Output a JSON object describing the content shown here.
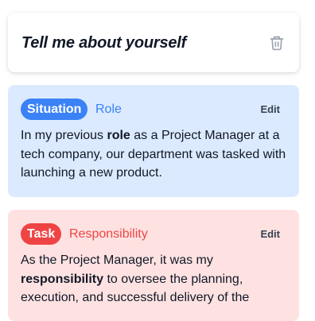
{
  "question": {
    "title": "Tell me about yourself",
    "delete_icon": "trash-icon"
  },
  "cards": [
    {
      "badge": "Situation",
      "subtitle": "Role",
      "edit_label": "Edit",
      "body_before": "In my previous ",
      "body_bold": "role",
      "body_after": " as a Project Manager at a tech company, our department was tasked with launching a new product.",
      "colors": {
        "background": "#dbeafe",
        "accent": "#3b82f6"
      }
    },
    {
      "badge": "Task",
      "subtitle": "Responsibility",
      "edit_label": "Edit",
      "body_before": "As the Project Manager, it was my ",
      "body_bold": "responsibility",
      "body_after": " to oversee the planning, execution, and successful delivery of the",
      "colors": {
        "background": "#fee2e2",
        "accent": "#ef4444"
      }
    }
  ]
}
